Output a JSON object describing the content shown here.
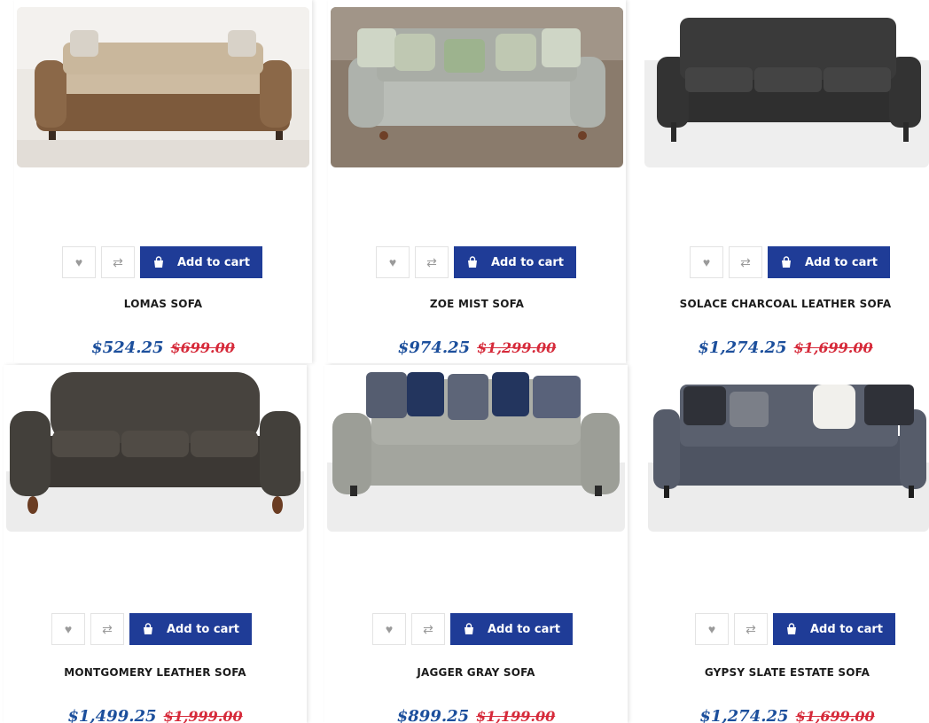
{
  "colors": {
    "accent": "#1f3c97",
    "sale_price": "#1c4f9c",
    "original_price": "#d62a3a"
  },
  "icons": {
    "wishlist": "heart-icon",
    "compare": "compare-arrows-icon",
    "cart": "shopping-bag-icon"
  },
  "products": [
    {
      "name": "LOMAS SOFA",
      "price": "$524.25",
      "original_price": "$699.00",
      "cart_label": "Add to cart",
      "image": "sofa-photo"
    },
    {
      "name": "ZOE MIST SOFA",
      "price": "$974.25",
      "original_price": "$1,299.00",
      "cart_label": "Add to cart",
      "image": "sofa-photo"
    },
    {
      "name": "SOLACE CHARCOAL LEATHER SOFA",
      "price": "$1,274.25",
      "original_price": "$1,699.00",
      "cart_label": "Add to cart",
      "image": "sofa-photo"
    },
    {
      "name": "MONTGOMERY LEATHER SOFA",
      "price": "$1,499.25",
      "original_price": "$1,999.00",
      "cart_label": "Add to cart",
      "image": "sofa-photo"
    },
    {
      "name": "JAGGER GRAY SOFA",
      "price": "$899.25",
      "original_price": "$1,199.00",
      "cart_label": "Add to cart",
      "image": "sofa-photo"
    },
    {
      "name": "GYPSY SLATE ESTATE SOFA",
      "price": "$1,274.25",
      "original_price": "$1,699.00",
      "cart_label": "Add to cart",
      "image": "sofa-photo"
    }
  ]
}
